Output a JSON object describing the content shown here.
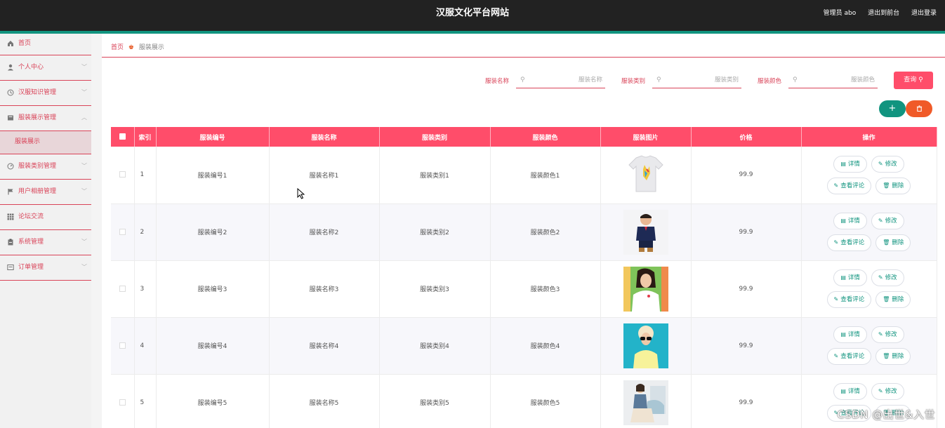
{
  "header": {
    "title": "汉服文化平台网站",
    "user": "管理员 abo",
    "to_front": "退出到前台",
    "logout": "退出登录"
  },
  "sidebar": {
    "items": [
      {
        "label": "首页",
        "icon": "home-icon"
      },
      {
        "label": "个人中心",
        "icon": "user-icon"
      },
      {
        "label": "汉服知识管理",
        "icon": "clock-icon"
      },
      {
        "label": "服装展示管理",
        "icon": "box-icon",
        "expanded": true
      },
      {
        "label": "服装类别管理",
        "icon": "gauge-icon"
      },
      {
        "label": "用户相册管理",
        "icon": "flag-icon"
      },
      {
        "label": "论坛交流",
        "icon": "grid-icon"
      },
      {
        "label": "系统管理",
        "icon": "clipboard-icon"
      },
      {
        "label": "订单管理",
        "icon": "message-icon"
      }
    ],
    "submenu_label": "服装展示"
  },
  "breadcrumb": {
    "home": "首页",
    "current": "服装展示"
  },
  "search": {
    "name_label": "服装名称",
    "name_placeholder": "服装名称",
    "type_label": "服装类别",
    "type_placeholder": "服装类别",
    "color_label": "服装颜色",
    "color_placeholder": "服装颜色",
    "query_button": "查询"
  },
  "actions": {
    "add_symbol": "+",
    "delete_symbol": "删"
  },
  "table": {
    "columns": [
      "索引",
      "服装编号",
      "服装名称",
      "服装类别",
      "服装颜色",
      "服装图片",
      "价格",
      "操作"
    ],
    "rows": [
      {
        "index": "1",
        "code": "服装编号1",
        "name": "服装名称1",
        "type": "服装类别1",
        "color": "服装颜色1",
        "price": "99.9"
      },
      {
        "index": "2",
        "code": "服装编号2",
        "name": "服装名称2",
        "type": "服装类别2",
        "color": "服装颜色2",
        "price": "99.9"
      },
      {
        "index": "3",
        "code": "服装编号3",
        "name": "服装名称3",
        "type": "服装类别3",
        "color": "服装颜色3",
        "price": "99.9"
      },
      {
        "index": "4",
        "code": "服装编号4",
        "name": "服装名称4",
        "type": "服装类别4",
        "color": "服装颜色4",
        "price": "99.9"
      },
      {
        "index": "5",
        "code": "服装编号5",
        "name": "服装名称5",
        "type": "服装类别5",
        "color": "服装颜色5",
        "price": "99.9"
      }
    ],
    "ops": {
      "detail": "详情",
      "edit": "修改",
      "comments": "查看评论",
      "delete": "删除"
    }
  },
  "watermark": "CSDN @出世&入世",
  "colors": {
    "accent": "#ff4d6a",
    "teal": "#11947f",
    "orange": "#f05a28",
    "header_bg": "#222222"
  }
}
